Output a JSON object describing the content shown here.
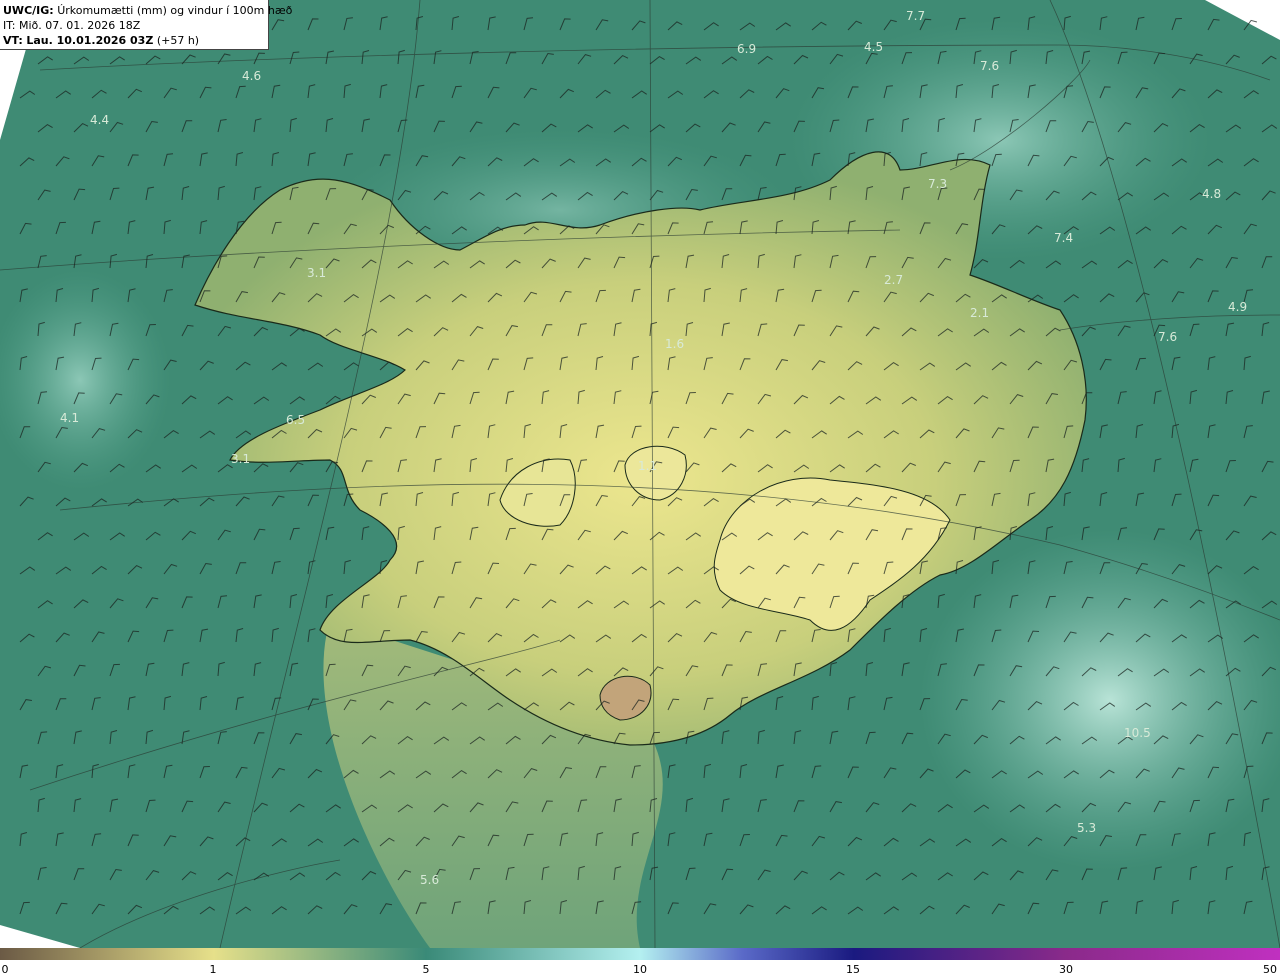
{
  "header": {
    "model": "UWC/IG:",
    "product": "Úrkomumætti (mm) og vindur í 100m hæð",
    "init_time": "IT: Mið. 07. 01. 2026 18Z",
    "valid_prefix": "VT:",
    "valid_time": "Lau. 10.01.2026 03Z",
    "lead_time": "(+57 h)"
  },
  "colorbar": {
    "ticks": [
      "0",
      "1",
      "5",
      "10",
      "15",
      "30",
      "50"
    ],
    "colors": [
      "#6b5a45",
      "#e6e08a",
      "#3a8a78",
      "#b4f0f0",
      "#1a1a80",
      "#8a2a8a",
      "#c030c0"
    ]
  },
  "map": {
    "sea_color": "#3d8a72",
    "land_color": "#c9cf7a",
    "value_labels": [
      "7.7",
      "6.9",
      "4.5",
      "7.6",
      "4.6",
      "4.4",
      "7.3",
      "4.8",
      "7.4",
      "3.1",
      "2.7",
      "4.9",
      "2.1",
      "7.6",
      "1.6",
      "4.1",
      "6.5",
      "3.1",
      "1.1",
      "10.5",
      "5.3",
      "5.6"
    ]
  }
}
